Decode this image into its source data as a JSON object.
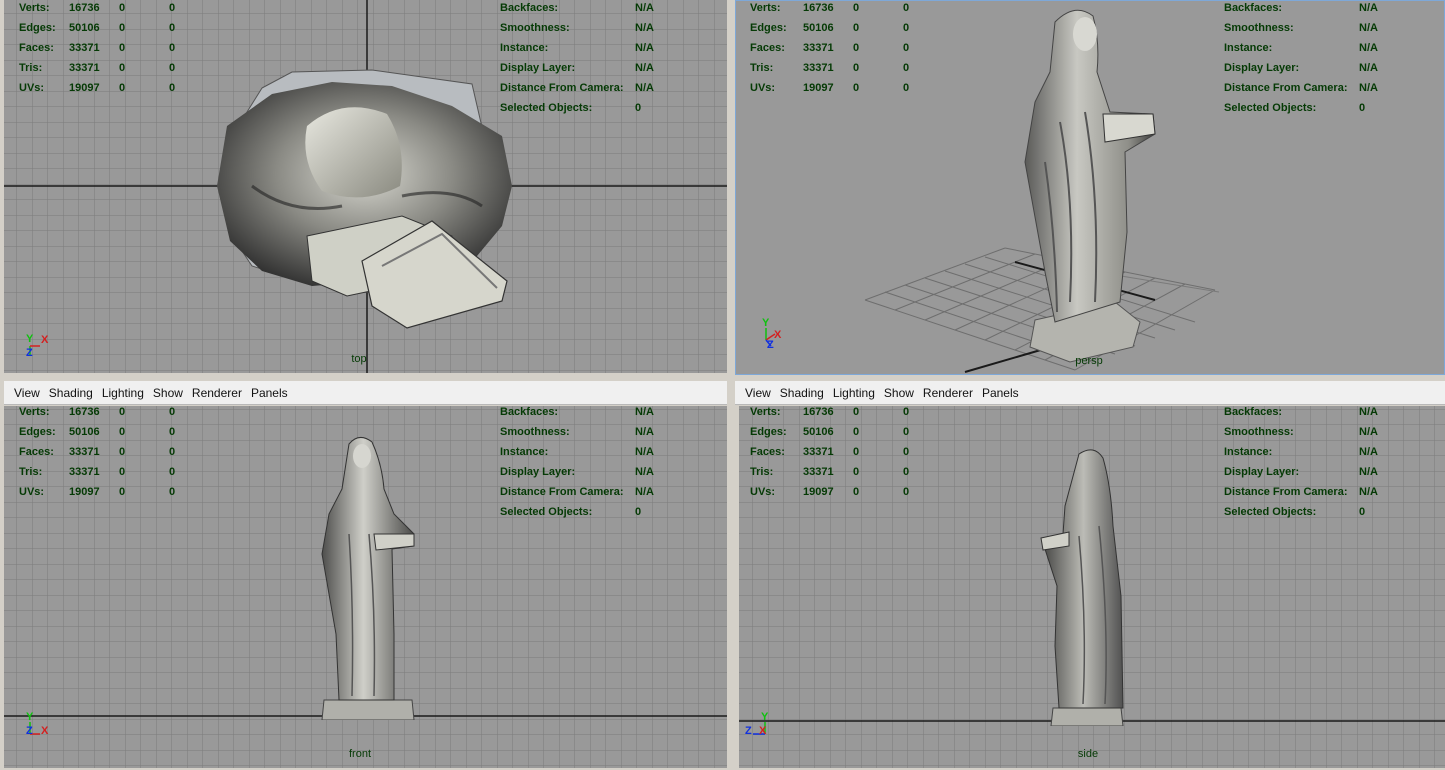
{
  "menu": [
    "View",
    "Shading",
    "Lighting",
    "Show",
    "Renderer",
    "Panels"
  ],
  "stats": {
    "rows": [
      {
        "label": "Verts:",
        "a": "16736",
        "b": "0",
        "c": "0"
      },
      {
        "label": "Edges:",
        "a": "50106",
        "b": "0",
        "c": "0"
      },
      {
        "label": "Faces:",
        "a": "33371",
        "b": "0",
        "c": "0"
      },
      {
        "label": "Tris:",
        "a": "33371",
        "b": "0",
        "c": "0"
      },
      {
        "label": "UVs:",
        "a": "19097",
        "b": "0",
        "c": "0"
      }
    ],
    "info": [
      {
        "label": "Backfaces:",
        "value": "N/A"
      },
      {
        "label": "Smoothness:",
        "value": "N/A"
      },
      {
        "label": "Instance:",
        "value": "N/A"
      },
      {
        "label": "Display Layer:",
        "value": "N/A"
      },
      {
        "label": "Distance From Camera:",
        "value": "N/A"
      },
      {
        "label": "Selected Objects:",
        "value": "0"
      }
    ]
  },
  "viewports": {
    "top": {
      "label": "top"
    },
    "persp": {
      "label": "persp"
    },
    "front": {
      "label": "front"
    },
    "side": {
      "label": "side"
    }
  },
  "axes": {
    "x": "X",
    "y": "Y",
    "z": "Z",
    "x_color": "#d42020",
    "y_color": "#10c010",
    "z_color": "#1030e0"
  },
  "colors": {
    "viewport_bg": "#999999",
    "hud_text": "#053a05",
    "grid": "#7c7c7c",
    "grid_axis": "#1a1a1a"
  }
}
